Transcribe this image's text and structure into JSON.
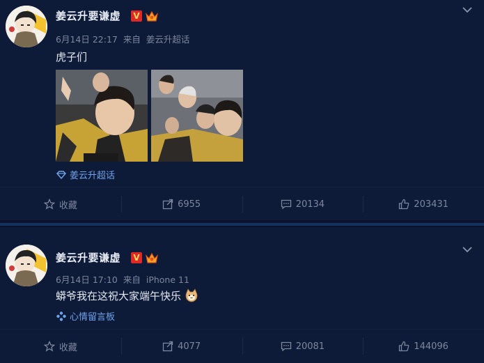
{
  "posts": [
    {
      "author": "姜云升要谦虚",
      "verified_badge": "V",
      "date": "6月14日 22:17",
      "source_prefix": "来自",
      "source": "姜云升超话",
      "text": "虎子们",
      "topic_icon": "diamond-icon",
      "topic": "姜云升超话",
      "photos": [
        "group-selfie-photo-1",
        "group-selfie-photo-2"
      ],
      "actions": {
        "favorite_label": "收藏",
        "repost_count": "6955",
        "comment_count": "20134",
        "like_count": "203431"
      }
    },
    {
      "author": "姜云升要谦虚",
      "verified_badge": "V",
      "date": "6月14日 17:10",
      "source_prefix": "来自",
      "source": "iPhone 11",
      "text": "蟒爷我在这祝大家端午快乐",
      "text_emoji": "cat-emoji",
      "topic_icon": "pinwheel-icon",
      "topic": "心情留言板",
      "actions": {
        "favorite_label": "收藏",
        "repost_count": "4077",
        "comment_count": "20081",
        "like_count": "144096"
      }
    }
  ],
  "colors": {
    "background": "#0d1a38",
    "link": "#6fa2ea",
    "muted": "#7d879e",
    "badge": "#e02828"
  }
}
